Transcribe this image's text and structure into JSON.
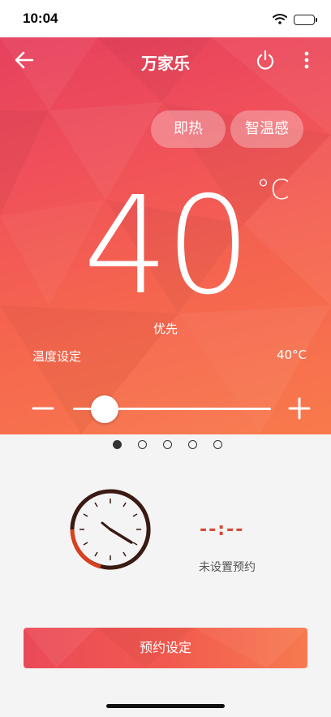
{
  "status_bar": {
    "time": "10:04"
  },
  "header": {
    "title": "万家乐"
  },
  "modes": {
    "instant_heat": "即热",
    "smart_temp": "智温感"
  },
  "temperature": {
    "current": "40",
    "unit": "°C",
    "mode_text": "优先"
  },
  "setting": {
    "label": "温度设定",
    "value": "40°C",
    "level": 0.17
  },
  "pager": {
    "count": 5,
    "active_index": 0
  },
  "schedule": {
    "time": "--:--",
    "status": "未设置预约",
    "button_label": "预约设定"
  },
  "colors": {
    "accent": "#f0505a",
    "schedule_text": "#d74a34",
    "clock_dark": "#3a1a12",
    "clock_red": "#d8401e"
  },
  "icons": [
    "back-arrow-icon",
    "power-icon",
    "more-vertical-icon",
    "minus-icon",
    "plus-icon",
    "clock-icon",
    "wifi-icon",
    "battery-charging-icon"
  ]
}
